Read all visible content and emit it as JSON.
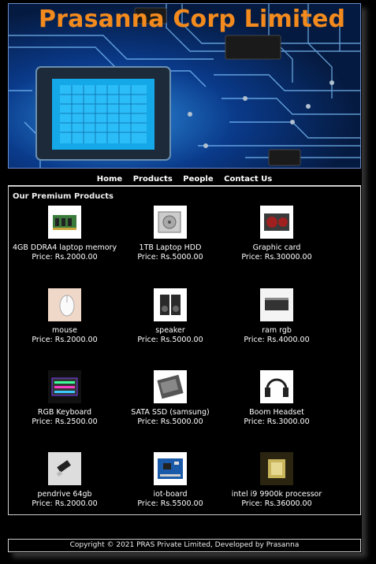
{
  "header": {
    "title": "Prasanna Corp Limited"
  },
  "nav": {
    "items": [
      "Home",
      "Products",
      "People",
      "Contact Us"
    ]
  },
  "products": {
    "section_title": "Our Premium Products",
    "items": [
      {
        "name": "4GB DDRA4 laptop memory",
        "price": "Price: Rs.2000.00",
        "icon": "ram-module-icon"
      },
      {
        "name": "1TB Laptop HDD",
        "price": "Price: Rs.5000.00",
        "icon": "hard-drive-icon"
      },
      {
        "name": "Graphic card",
        "price": "Price: Rs.30000.00",
        "icon": "graphics-card-icon"
      },
      {
        "name": "mouse",
        "price": "Price: Rs.2000.00",
        "icon": "mouse-icon"
      },
      {
        "name": "speaker",
        "price": "Price: Rs.5000.00",
        "icon": "speaker-icon"
      },
      {
        "name": "ram rgb",
        "price": "Price: Rs.4000.00",
        "icon": "rgb-ram-icon"
      },
      {
        "name": "RGB Keyboard",
        "price": "Price: Rs.2500.00",
        "icon": "keyboard-icon"
      },
      {
        "name": "SATA SSD (samsung)",
        "price": "Price: Rs.5000.00",
        "icon": "ssd-icon"
      },
      {
        "name": "Boom Headset",
        "price": "Price: Rs.3000.00",
        "icon": "headset-icon"
      },
      {
        "name": "pendrive 64gb",
        "price": "Price: Rs.2000.00",
        "icon": "usb-drive-icon"
      },
      {
        "name": "iot-board",
        "price": "Price: Rs.5500.00",
        "icon": "circuit-board-icon"
      },
      {
        "name": "intel i9 9900k processor",
        "price": "Price: Rs.36000.00",
        "icon": "processor-icon"
      }
    ]
  },
  "footer": {
    "text": "Copyright © 2021 PRAS Private Limited, Developed by Prasanna"
  },
  "colors": {
    "title": "#f28a1e",
    "background": "#000000",
    "border": "#cfcfcf"
  }
}
